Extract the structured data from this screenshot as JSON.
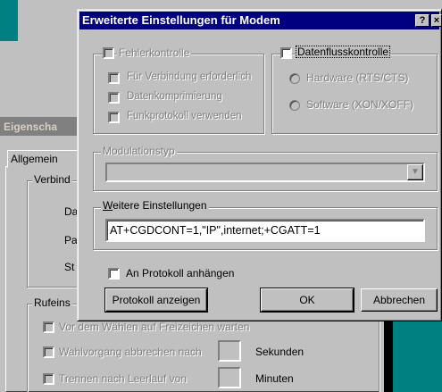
{
  "background_window": {
    "title": "Eigenscha",
    "tab_label": "Allgemein",
    "group_connection": "Verbind",
    "label_da": "Da",
    "label_pa": "Pa",
    "label_st": "St",
    "group_dial": "Rufeins",
    "check_wait_tone": "Vor dem Wählen auf Freizeichen warten",
    "check_cancel_dial": "Wahlvorgang abbrechen nach",
    "unit_seconds": "Sekunden",
    "check_disconnect_idle": "Trennen nach Leerlauf von",
    "unit_minutes": "Minuten"
  },
  "dialog": {
    "title": "Erweiterte Einstellungen für Modem",
    "help_glyph": "?",
    "close_glyph": "×",
    "error_control": {
      "label": "Fehlerkontrolle",
      "required": "Für Verbindung erforderlich",
      "compression": "Datenkomprimierung",
      "cellular": "Funkprotokoll verwenden"
    },
    "flow_control": {
      "label": "Datenflusskontrolle",
      "hardware": "Hardware (RTS/CTS)",
      "software": "Software (XON/XOFF)"
    },
    "modulation": {
      "label": "Modulationstyp",
      "value": ""
    },
    "extra_settings": {
      "label": "Weitere Einstellungen",
      "value": "AT+CGDCONT=1,\"IP\",internet;+CGATT=1"
    },
    "append_log": "An Protokoll anhängen",
    "buttons": {
      "view_log": "Protokoll anzeigen",
      "ok": "OK",
      "cancel": "Abbrechen"
    }
  },
  "colors": {
    "title_bar": "#000080",
    "desktop": "#008080",
    "face": "#c0c0c0"
  }
}
